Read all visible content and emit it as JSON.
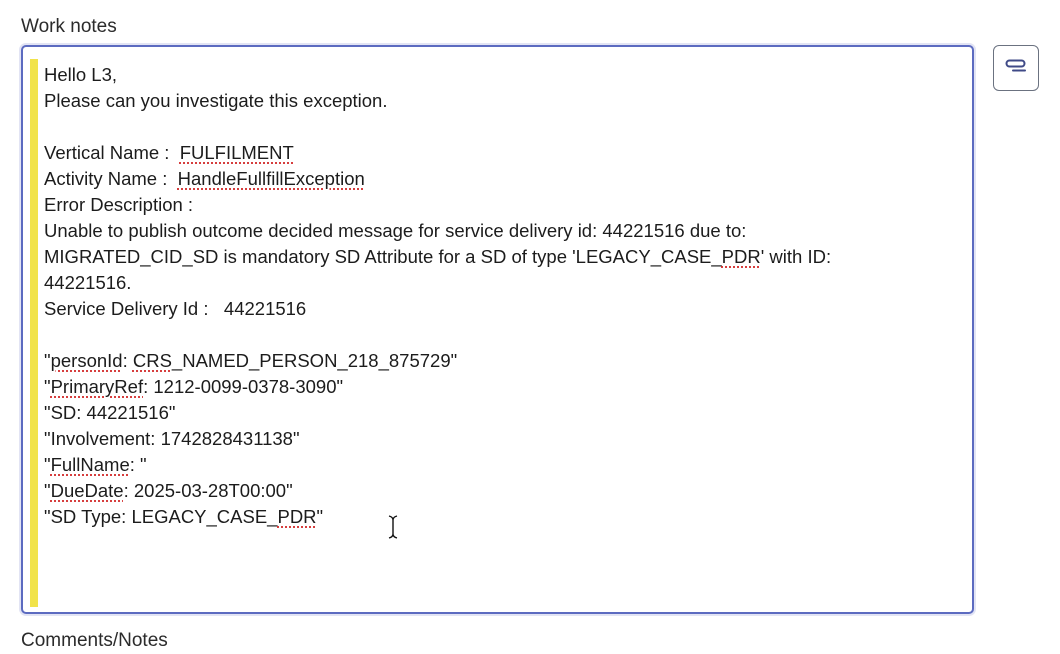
{
  "work_notes": {
    "label": "Work notes",
    "lines": {
      "l0": "Hello L3,",
      "l1": "Please can you investigate this exception.",
      "l3_prefix": "Vertical Name :  ",
      "l3_value": "FULFILMENT",
      "l4_prefix": "Activity Name :  ",
      "l4_value": "HandleFullfillException",
      "l5": "Error Description :",
      "l6": "Unable to publish outcome decided message for service delivery id: 44221516 due to:",
      "l7_prefix": "MIGRATED_CID_SD is mandatory SD Attribute for a SD of type 'LEGACY_CASE_",
      "l7_spell": "PDR",
      "l7_suffix": "' with ID:",
      "l8": "44221516.",
      "l9": "Service Delivery Id :   44221516",
      "l11_quote": "\"",
      "l11_spell1": "personId",
      "l11_mid": ": ",
      "l11_spell2": "CRS",
      "l11_rest": "_NAMED_PERSON_218_875729\"",
      "l12_quote": "\"",
      "l12_spell": "PrimaryRef",
      "l12_rest": ": 1212-0099-0378-3090\"",
      "l13": "\"SD: 44221516\"",
      "l14": "\"Involvement: 1742828431138\"",
      "l15_quote": "\"",
      "l15_spell": "FullName",
      "l15_rest": ": \"",
      "l16_quote": "\"",
      "l16_spell": "DueDate",
      "l16_rest": ": 2025-03-28T00:00\"",
      "l17_prefix": "\"SD Type: LEGACY_CASE_",
      "l17_spell": "PDR",
      "l17_suffix": "\""
    }
  },
  "comments": {
    "label": "Comments/Notes"
  },
  "side_button": {
    "icon": "message-toggle-icon"
  },
  "colors": {
    "focus_border": "#5c6bc0",
    "mandatory_bar": "#f1e34a",
    "spellcheck_underline": "#d32f2f"
  }
}
